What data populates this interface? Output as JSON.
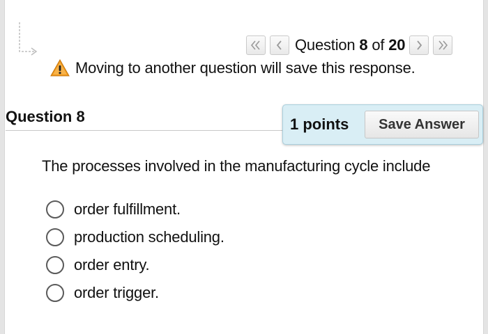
{
  "navigation": {
    "counter_prefix": "Question ",
    "current_question": "8",
    "counter_middle": " of ",
    "total_questions": "20",
    "first_icon": "double-chevron-left-icon",
    "prev_icon": "chevron-left-icon",
    "next_icon": "chevron-right-icon",
    "last_icon": "double-chevron-right-icon"
  },
  "warning": {
    "icon": "warning-triangle-icon",
    "text": "Moving to another question will save this response."
  },
  "question": {
    "title": "Question 8",
    "points": "1 points",
    "save_label": "Save Answer",
    "prompt": "The processes involved in the manufacturing cycle include",
    "options": [
      {
        "label": "order fulfillment."
      },
      {
        "label": "production scheduling."
      },
      {
        "label": "order entry."
      },
      {
        "label": "order trigger."
      }
    ]
  },
  "colors": {
    "points_box_bg": "#d9eef5",
    "warning_orange": "#f29a1b"
  }
}
